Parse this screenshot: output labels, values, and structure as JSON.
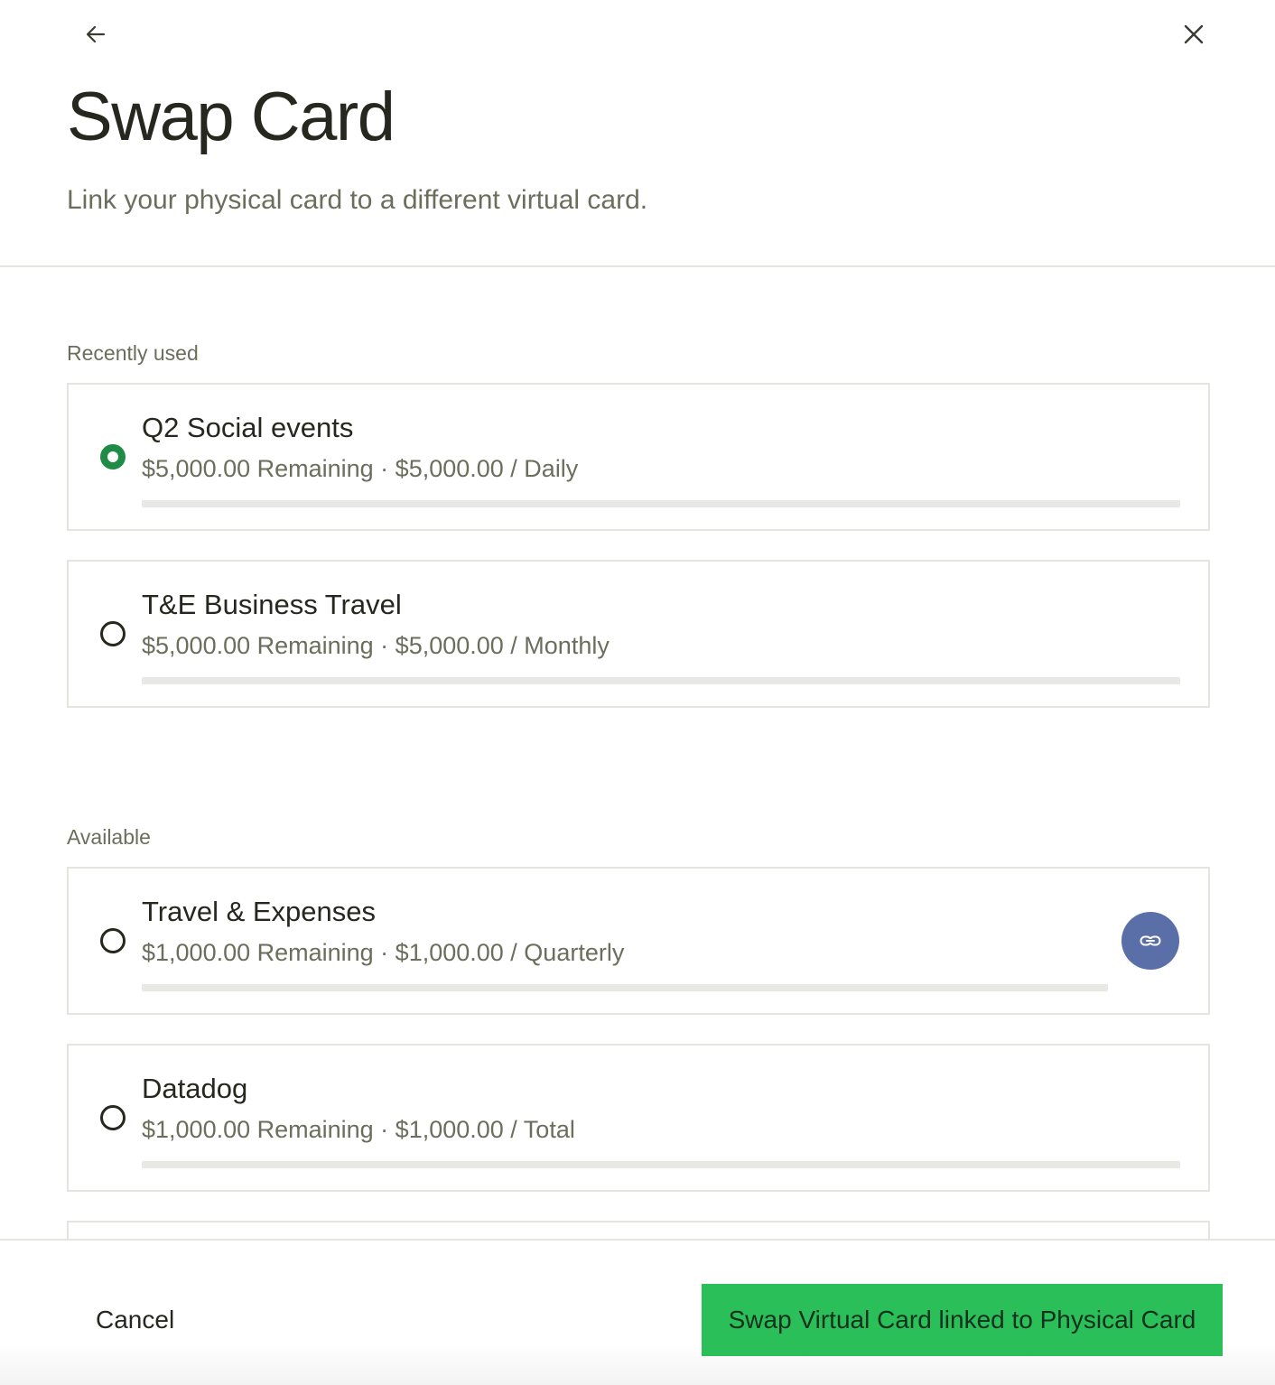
{
  "header": {
    "title": "Swap Card",
    "subtitle": "Link your physical card to a different virtual card."
  },
  "sections": {
    "recent_label": "Recently used",
    "available_label": "Available"
  },
  "cards": [
    {
      "name": "Q2 Social events",
      "meta": "$5,000.00 Remaining · $5,000.00 / Daily",
      "selected": true
    },
    {
      "name": "T&E Business Travel",
      "meta": "$5,000.00 Remaining · $5,000.00 / Monthly",
      "selected": false
    },
    {
      "name": "Travel & Expenses",
      "meta": "$1,000.00 Remaining · $1,000.00 / Quarterly",
      "selected": false,
      "linked": true
    },
    {
      "name": "Datadog",
      "meta": "$1,000.00 Remaining · $1,000.00 / Total",
      "selected": false
    }
  ],
  "footer": {
    "cancel_label": "Cancel",
    "primary_label": "Swap Virtual Card linked to Physical Card"
  },
  "colors": {
    "accent_green": "#2bbf5a",
    "radio_green": "#1f8b46",
    "link_blue": "#5a6ea8"
  },
  "icons": [
    "arrow-left-icon",
    "close-icon",
    "link-icon"
  ]
}
